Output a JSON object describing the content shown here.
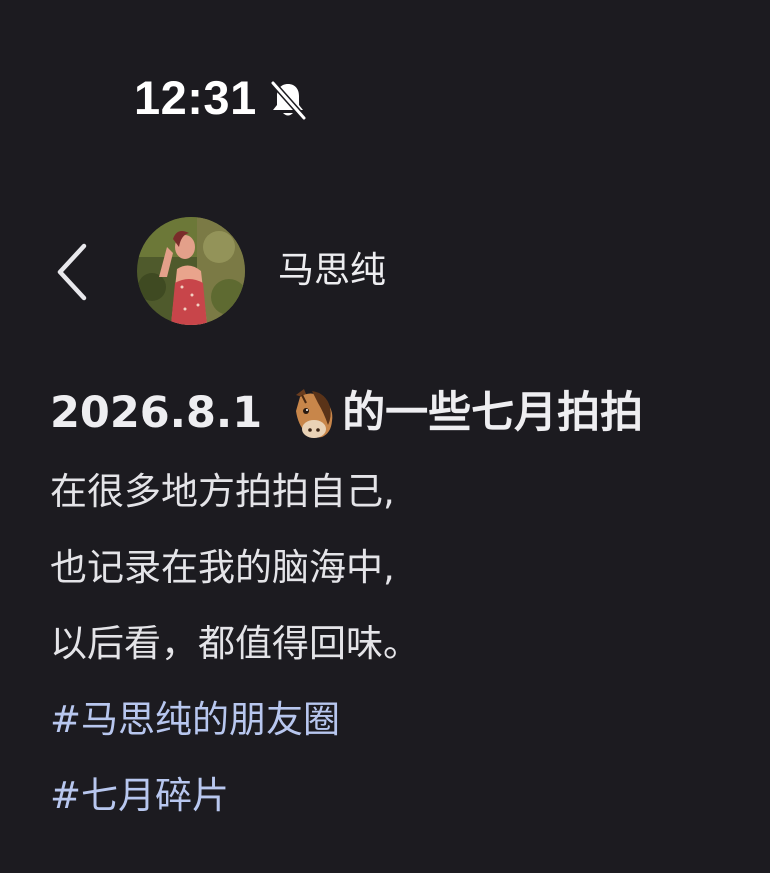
{
  "status_bar": {
    "time": "12:31",
    "silent_icon": "bell-slash-icon"
  },
  "header": {
    "back_icon": "chevron-left-icon",
    "author_name": "马思纯"
  },
  "post": {
    "title_date": "2026.8.1",
    "title_emoji": "horse-face-icon",
    "title_text": "的一些七月拍拍",
    "lines": [
      "在很多地方拍拍自己,",
      "也记录在我的脑海中,",
      "以后看，都值得回味。"
    ],
    "tags": [
      "#马思纯的朋友圈",
      "#七月碎片"
    ]
  },
  "colors": {
    "background": "#1c1b20",
    "text": "#e6e6e9",
    "tag": "#b8c7ef"
  }
}
